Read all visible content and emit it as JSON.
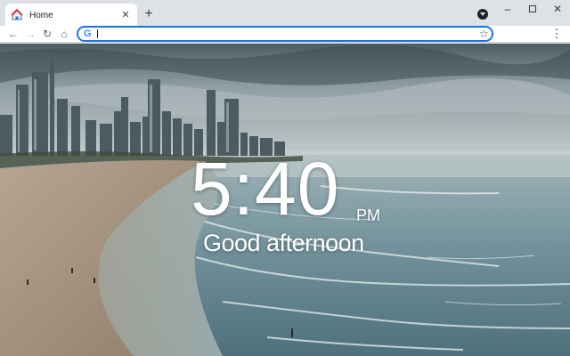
{
  "browser": {
    "tab": {
      "title": "Home",
      "favicon": "house-icon"
    },
    "new_tab_icon": "+",
    "tab_close_icon": "✕",
    "window_controls": {
      "minimize": "–",
      "close": "✕"
    },
    "toolbar": {
      "back_icon": "←",
      "forward_icon": "→",
      "reload_icon": "↻",
      "home_icon": "⌂",
      "bookmark_icon": "☆",
      "menu_icon": "⋮"
    },
    "omnibox": {
      "search_engine_icon": "G",
      "value": "",
      "placeholder": ""
    }
  },
  "page": {
    "clock": {
      "time": "5:40",
      "period": "PM"
    },
    "greeting": "Good afternoon",
    "background": {
      "scene": "beach-city-skyline"
    }
  },
  "colors": {
    "tabstrip": "#dee1e6",
    "omnibox_focus": "#1a73e8",
    "clock_text": "#ffffff"
  }
}
